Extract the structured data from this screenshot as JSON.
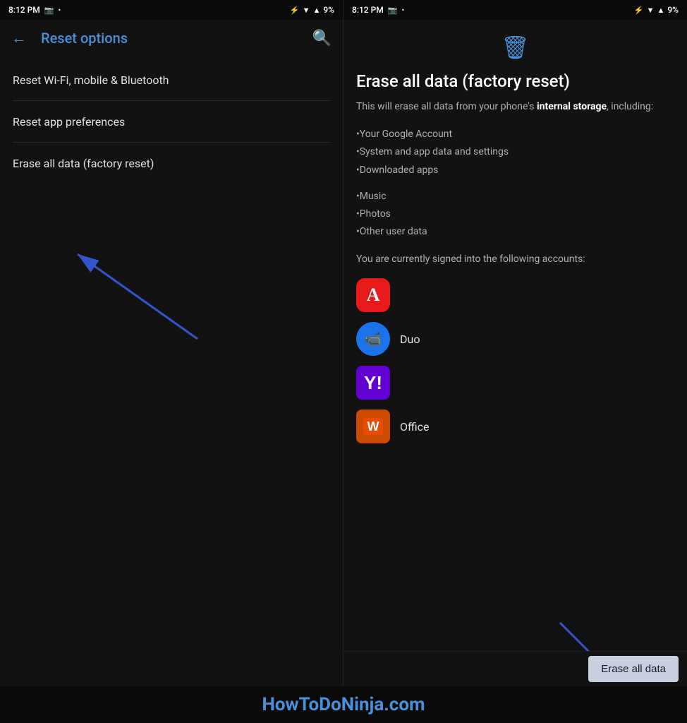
{
  "left_status": {
    "time": "8:12 PM",
    "battery": "9%"
  },
  "right_status": {
    "time": "8:12 PM",
    "battery": "9%"
  },
  "left_screen": {
    "title": "Reset options",
    "back_label": "←",
    "search_label": "🔍",
    "menu_items": [
      {
        "id": "wifi-reset",
        "label": "Reset Wi-Fi, mobile & Bluetooth"
      },
      {
        "id": "app-prefs",
        "label": "Reset app preferences"
      },
      {
        "id": "factory-reset",
        "label": "Erase all data (factory reset)"
      }
    ]
  },
  "right_screen": {
    "title": "Erase all data (factory reset)",
    "description_prefix": "This will erase all data from your phone's ",
    "description_bold": "internal storage",
    "description_suffix": ", including:",
    "items_group1": [
      "•Your Google Account",
      "•System and app data and settings",
      "•Downloaded apps"
    ],
    "items_group2": [
      "•Music",
      "•Photos",
      "•Other user data"
    ],
    "accounts_intro": "You are currently signed into the following accounts:",
    "accounts": [
      {
        "id": "adobe",
        "label": ""
      },
      {
        "id": "duo",
        "label": "Duo"
      },
      {
        "id": "yahoo",
        "label": ""
      },
      {
        "id": "office",
        "label": "Office"
      }
    ],
    "erase_button_label": "Erase all data"
  },
  "watermark": {
    "text": "HowToDoNinja.com"
  }
}
